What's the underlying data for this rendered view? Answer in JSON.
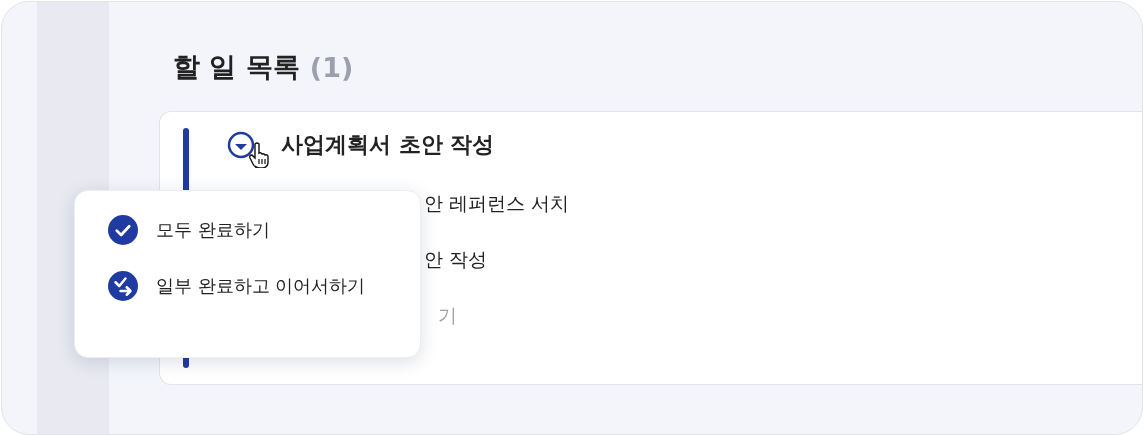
{
  "title": "할 일 목록",
  "count": "(1)",
  "task": {
    "title": "사업계획서 초안 작성",
    "checked": false,
    "subtasks": [
      {
        "text": "안 레퍼런스 서치",
        "muted": false
      },
      {
        "text": "안 작성",
        "muted": false
      },
      {
        "text": "기",
        "muted": true
      }
    ]
  },
  "menu": [
    {
      "kind": "all",
      "label": "모두 완료하기"
    },
    {
      "kind": "partial",
      "label": "일부 완료하고 이어서하기"
    }
  ]
}
